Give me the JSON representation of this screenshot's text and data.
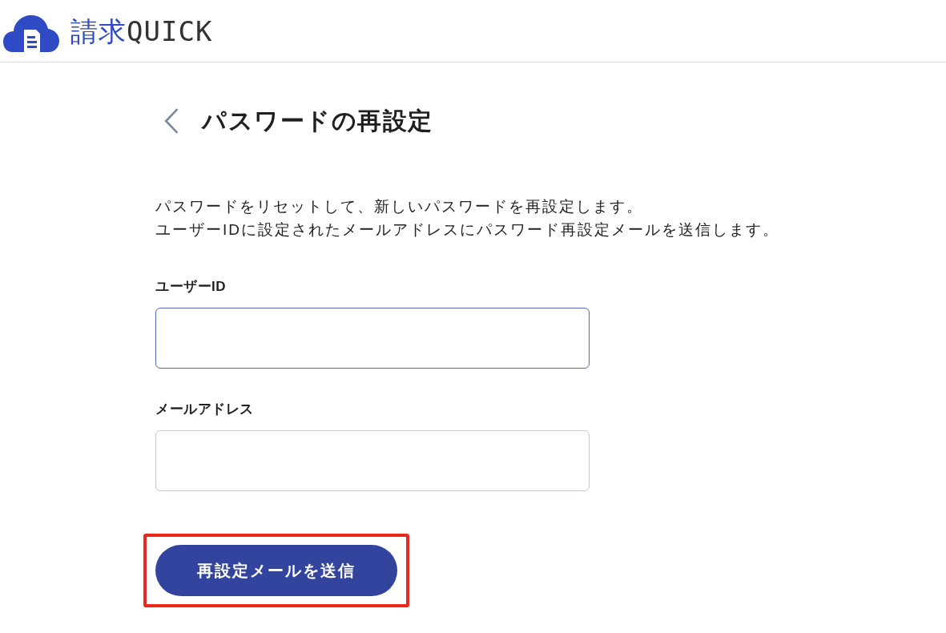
{
  "header": {
    "logo": {
      "prefix": "請求",
      "name": "QUICK"
    }
  },
  "page": {
    "title": "パスワードの再設定",
    "description": [
      "パスワードをリセットして、新しいパスワードを再設定します。",
      "ユーザーIDに設定されたメールアドレスにパスワード再設定メールを送信します。"
    ]
  },
  "form": {
    "fields": [
      {
        "label": "ユーザーID",
        "focused": true
      },
      {
        "label": "メールアドレス",
        "focused": false
      }
    ],
    "submit": {
      "label": "再設定メールを送信",
      "highlighted": true
    }
  }
}
